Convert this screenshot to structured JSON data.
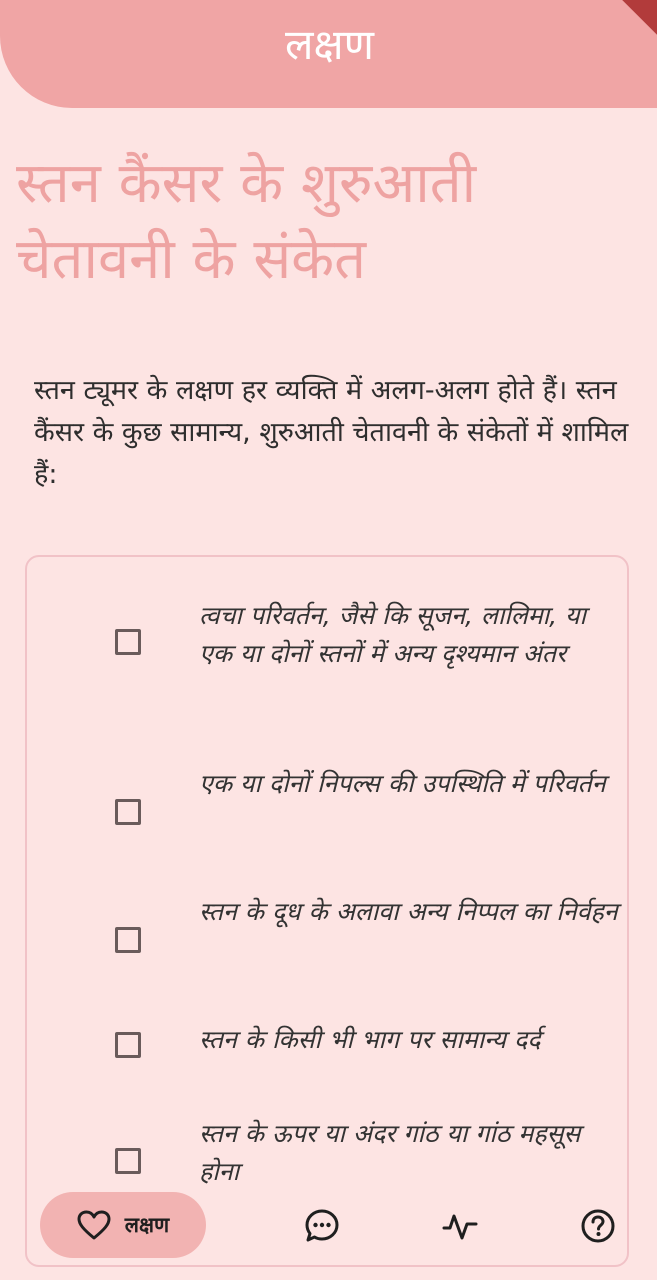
{
  "app_bar": {
    "title": "लक्षण"
  },
  "page": {
    "headline": "स्तन कैंसर के शुरुआती चेतावनी के संकेत",
    "intro": "स्तन ट्यूमर के लक्षण हर व्यक्ति में अलग-अलग होते हैं। स्तन कैंसर के कुछ सामान्य, शुरुआती चेतावनी के संकेतों में शामिल हैं:"
  },
  "symptoms": [
    {
      "text": "त्वचा परिवर्तन, जैसे कि सूजन, लालिमा, या एक या दोनों स्तनों में अन्य दृश्यमान अंतर",
      "checked": false
    },
    {
      "text": "एक या दोनों निपल्स की उपस्थिति में परिवर्तन",
      "checked": false
    },
    {
      "text": "स्तन के दूध के अलावा अन्य निप्पल का निर्वहन",
      "checked": false
    },
    {
      "text": "स्तन के किसी भी भाग पर सामान्य दर्द",
      "checked": false
    },
    {
      "text": "स्तन के ऊपर या अंदर गांठ या गांठ महसूस होना",
      "checked": false
    }
  ],
  "bottom_nav": {
    "active_label": "लक्षण",
    "items": [
      {
        "icon": "heart-icon",
        "label": "लक्षण",
        "active": true
      },
      {
        "icon": "chat-icon",
        "active": false
      },
      {
        "icon": "activity-icon",
        "active": false
      },
      {
        "icon": "help-icon",
        "active": false
      }
    ]
  },
  "colors": {
    "background": "#fde4e3",
    "app_bar": "#f0a5a5",
    "headline": "#eea3a2",
    "card_border": "#f1c2c7",
    "nav_active_pill": "#f2b3b2"
  }
}
